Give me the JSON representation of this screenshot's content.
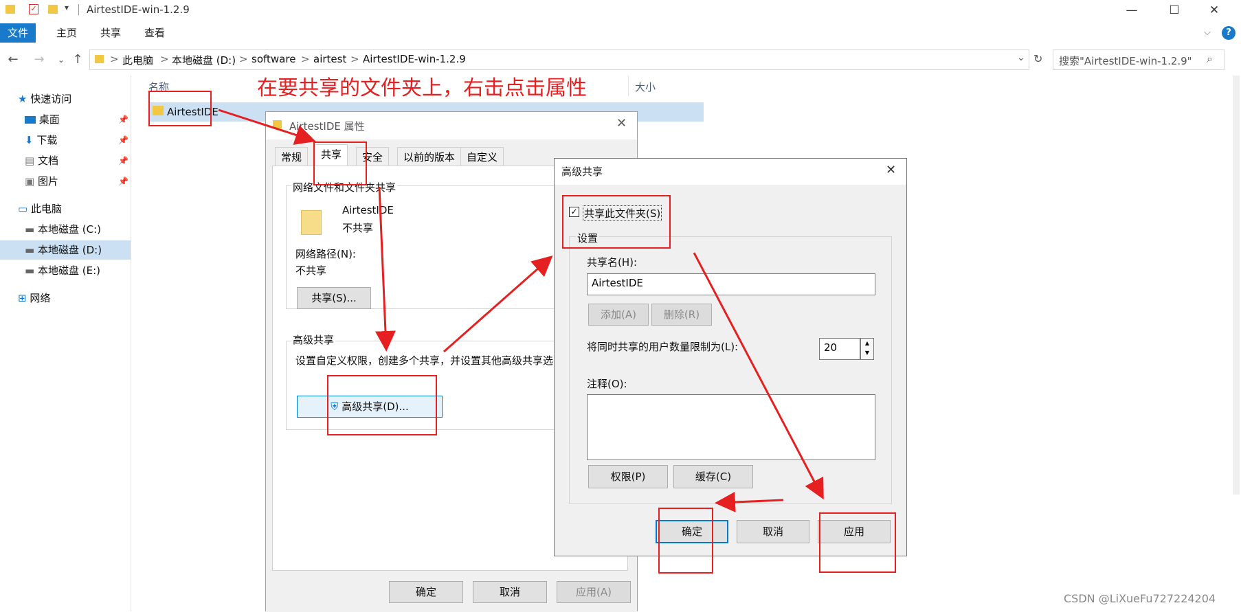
{
  "window": {
    "title": "AirtestIDE-win-1.2.9",
    "minimize": "—",
    "maximize": "☐",
    "close": "✕"
  },
  "ribbon": {
    "tabs": [
      "文件",
      "主页",
      "共享",
      "查看"
    ],
    "help": "?"
  },
  "address": {
    "crumbs": [
      "此电脑",
      "本地磁盘 (D:)",
      "software",
      "airtest",
      "AirtestIDE-win-1.2.9"
    ],
    "separator": ">",
    "search_placeholder": "搜索\"AirtestIDE-win-1.2.9\""
  },
  "nav": {
    "quick_access": "快速访问",
    "items": [
      "桌面",
      "下载",
      "文档",
      "图片"
    ],
    "this_pc": "此电脑",
    "drives": [
      "本地磁盘 (C:)",
      "本地磁盘 (D:)",
      "本地磁盘 (E:)"
    ],
    "network": "网络"
  },
  "filelist": {
    "col_name": "名称",
    "col_size": "大小",
    "rows": [
      {
        "name": "AirtestIDE"
      }
    ]
  },
  "annotation": "在要共享的文件夹上，右击点击属性",
  "props": {
    "title": "AirtestIDE 属性",
    "tabs": [
      "常规",
      "共享",
      "安全",
      "以前的版本",
      "自定义"
    ],
    "group1_title": "网络文件和文件夹共享",
    "folder_name": "AirtestIDE",
    "folder_status": "不共享",
    "path_label": "网络路径(N):",
    "path_value": "不共享",
    "share_button": "共享(S)...",
    "group2_title": "高级共享",
    "group2_desc": "设置自定义权限，创建多个共享，并设置其他高级共享选",
    "adv_button": "高级共享(D)...",
    "ok": "确定",
    "cancel": "取消",
    "apply": "应用(A)"
  },
  "adv": {
    "title": "高级共享",
    "share_checkbox": "共享此文件夹(S)",
    "settings": "设置",
    "share_name_label": "共享名(H):",
    "share_name_value": "AirtestIDE",
    "add": "添加(A)",
    "remove": "删除(R)",
    "limit_label": "将同时共享的用户数量限制为(L):",
    "limit_value": "20",
    "comment_label": "注释(O):",
    "permissions": "权限(P)",
    "caching": "缓存(C)",
    "ok": "确定",
    "cancel": "取消",
    "apply": "应用"
  },
  "watermark": "CSDN @LiXueFu727224204",
  "colors": {
    "accent": "#1979ca",
    "selection": "#cce0f4",
    "annotation_red": "#e62020"
  }
}
